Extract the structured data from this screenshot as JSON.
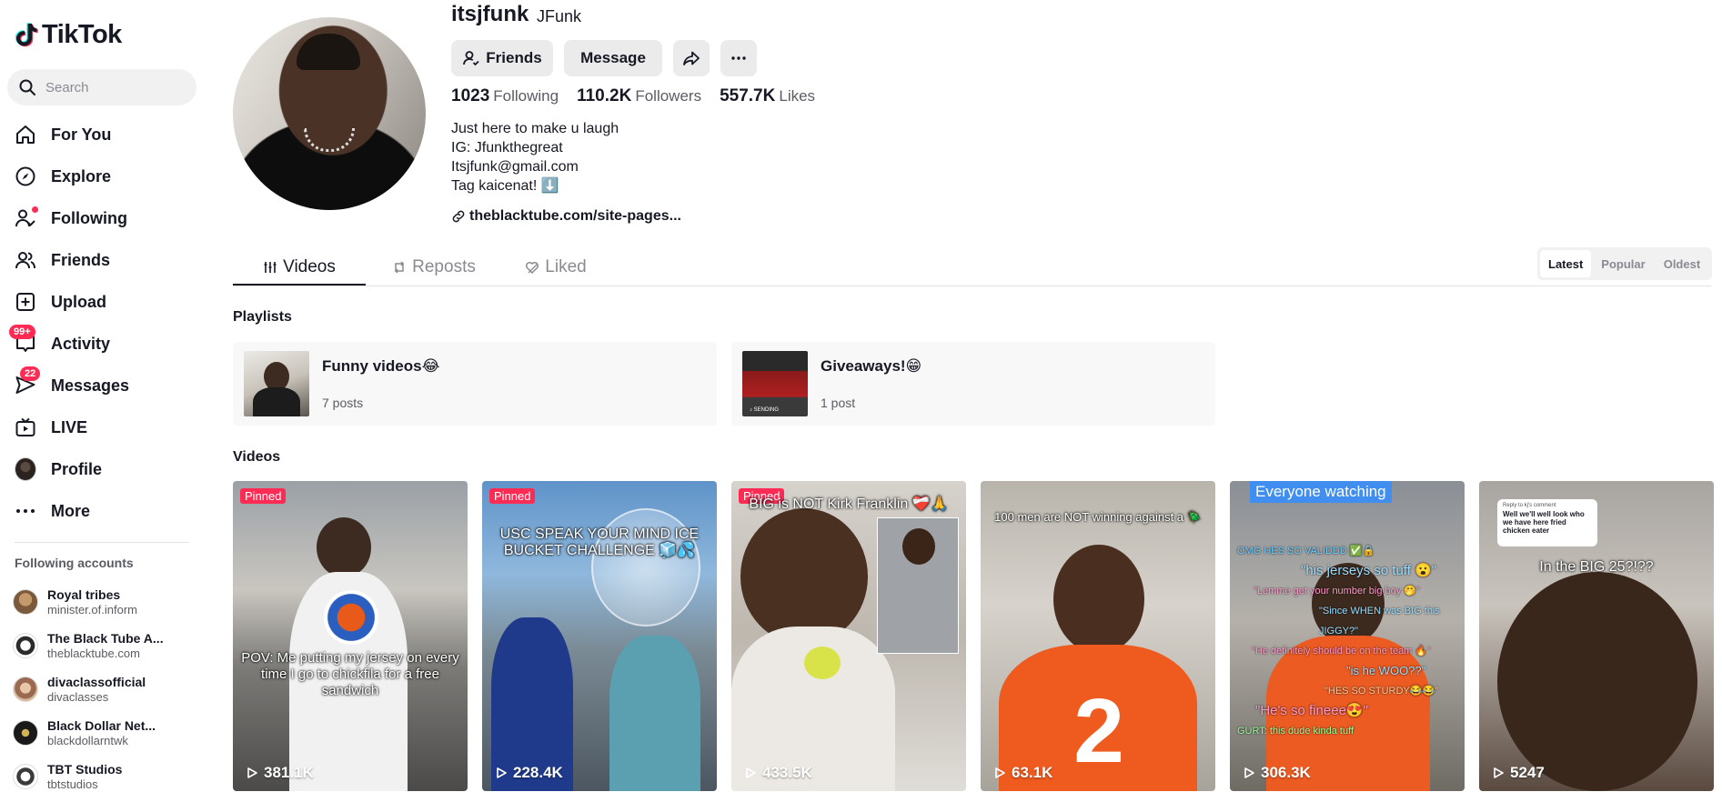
{
  "app": {
    "logo_text": "TikTok"
  },
  "search": {
    "placeholder": "Search"
  },
  "nav": [
    {
      "label": "For You",
      "icon": "home-icon"
    },
    {
      "label": "Explore",
      "icon": "compass-icon"
    },
    {
      "label": "Following",
      "icon": "following-icon"
    },
    {
      "label": "Friends",
      "icon": "friends-icon"
    },
    {
      "label": "Upload",
      "icon": "upload-icon"
    },
    {
      "label": "Activity",
      "icon": "activity-icon",
      "badge": "99+"
    },
    {
      "label": "Messages",
      "icon": "messages-icon",
      "badge": "22"
    },
    {
      "label": "LIVE",
      "icon": "live-icon"
    },
    {
      "label": "Profile",
      "icon": "profile-avatar"
    },
    {
      "label": "More",
      "icon": "more-icon"
    }
  ],
  "following_accounts": {
    "title": "Following accounts",
    "items": [
      {
        "name": "Royal tribes",
        "handle": "minister.of.inform",
        "color": "#7a5a3a"
      },
      {
        "name": "The Black Tube A...",
        "handle": "theblacktube.com",
        "color": "#2b2b2b"
      },
      {
        "name": "divaclassofficial",
        "handle": "divaclasses",
        "color": "#b08a6a"
      },
      {
        "name": "Black Dollar Net...",
        "handle": "blackdollarntwk",
        "color": "#1a1a1a"
      },
      {
        "name": "TBT Studios",
        "handle": "tbtstudios",
        "color": "#3a3a3a"
      }
    ]
  },
  "profile": {
    "username": "itsjfunk",
    "nickname": "JFunk",
    "buttons": {
      "friends": "Friends",
      "message": "Message"
    },
    "stats": [
      {
        "value": "1023",
        "label": "Following"
      },
      {
        "value": "110.2K",
        "label": "Followers"
      },
      {
        "value": "557.7K",
        "label": "Likes"
      }
    ],
    "bio": [
      "Just here to make u laugh",
      "IG: Jfunkthegreat",
      "Itsjfunk@gmail.com",
      "Tag kaicenat! ⬇️"
    ],
    "link": "theblacktube.com/site-pages..."
  },
  "tabs": [
    {
      "label": "Videos",
      "icon": "grid-icon"
    },
    {
      "label": "Reposts",
      "icon": "repost-icon"
    },
    {
      "label": "Liked",
      "icon": "heart-icon"
    }
  ],
  "sort": [
    "Latest",
    "Popular",
    "Oldest"
  ],
  "playlists": {
    "title": "Playlists",
    "items": [
      {
        "name": "Funny videos😂",
        "count": "7 posts"
      },
      {
        "name": "Giveaways!😁",
        "count": "1 post"
      }
    ]
  },
  "videos": {
    "title": "Videos",
    "pinned_label": "Pinned",
    "items": [
      {
        "views": "381.1K",
        "pinned": true,
        "caption": "POV: Me putting my jersey on every time I go to chickfila for a free sandwich"
      },
      {
        "views": "228.4K",
        "pinned": true,
        "caption": "USC SPEAK YOUR MIND ICE BUCKET CHALLENGE 🧊💦"
      },
      {
        "views": "433.5K",
        "pinned": true,
        "caption": "BIG is NOT Kirk Franklin ❤️‍🩹🙏"
      },
      {
        "views": "63.1K",
        "pinned": false,
        "caption": "100 men are NOT winning against a 🪲"
      },
      {
        "views": "306.3K",
        "pinned": false,
        "caption": "Everyone watching"
      },
      {
        "views": "5247",
        "pinned": false,
        "caption": "In the BIG 25?!??",
        "reply": "Well we'll well look who we have here fried chicken eater",
        "reply_header": "Reply to kj's comment"
      }
    ]
  },
  "colors": {
    "accent": "#fe2c55",
    "text": "#161823",
    "muted": "#5b5c63"
  }
}
